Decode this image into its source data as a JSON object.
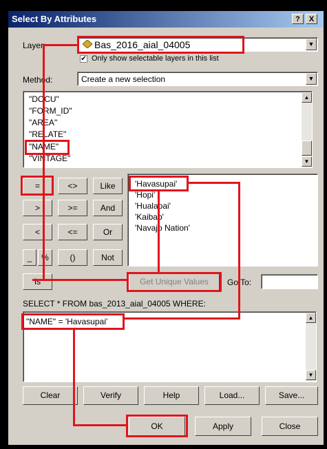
{
  "title": "Select By Attributes",
  "title_buttons": {
    "help": "?",
    "close": "X"
  },
  "layer": {
    "label": "Layer:",
    "value": "Bas_2016_aial_04005",
    "selectable_only": "Only show selectable layers in this list"
  },
  "method": {
    "label": "Method:",
    "value": "Create a new selection"
  },
  "fields": [
    "\"DOCU\"",
    "\"FORM_ID\"",
    "\"AREA\"",
    "\"RELATE\"",
    "\"NAME\"",
    "\"VINTAGE\""
  ],
  "operators": {
    "eq": "=",
    "ne": "<>",
    "like": "Like",
    "gt": ">",
    "ge": ">=",
    "and": "And",
    "lt": "<",
    "le": "<=",
    "or": "Or",
    "underscore": "_",
    "percent": "%",
    "parens": "()",
    "not": "Not",
    "is": "Is"
  },
  "values": [
    "'Havasupai'",
    "'Hopi'",
    "'Hualapai'",
    "'Kaibab'",
    "'Navajo Nation'"
  ],
  "get_unique_values": "Get Unique Values",
  "goto_label": "Go To:",
  "goto_value": "",
  "sql_prefix": "SELECT * FROM bas_2013_aial_04005 WHERE:",
  "expression": "\"NAME\" = 'Havasupai'",
  "buttons": {
    "clear": "Clear",
    "verify": "Verify",
    "help": "Help",
    "load": "Load...",
    "save": "Save..."
  },
  "bottom": {
    "ok": "OK",
    "apply": "Apply",
    "close": "Close"
  },
  "colors": {
    "highlight": "#e0151c",
    "titlebar_start": "#0a246a",
    "titlebar_end": "#a6caf0",
    "face": "#d4d0c8"
  }
}
